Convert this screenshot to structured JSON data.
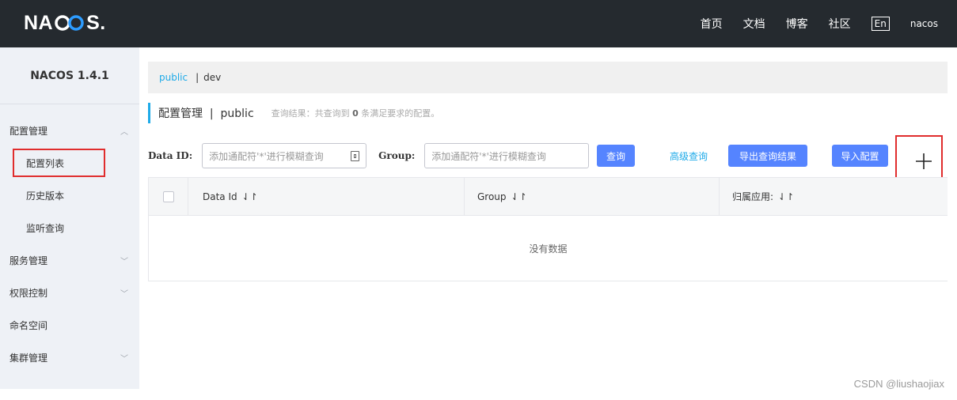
{
  "header": {
    "logo_text_left": "NA",
    "logo_text_right": "S.",
    "nav": [
      "首页",
      "文档",
      "博客",
      "社区"
    ],
    "lang": "En",
    "user": "nacos"
  },
  "sidebar": {
    "title": "NACOS 1.4.1",
    "items": [
      {
        "label": "配置管理",
        "arrow": "^"
      },
      {
        "label": "配置列表"
      },
      {
        "label": "历史版本"
      },
      {
        "label": "监听查询"
      },
      {
        "label": "服务管理",
        "arrow": "v"
      },
      {
        "label": "权限控制",
        "arrow": "v"
      },
      {
        "label": "命名空间"
      },
      {
        "label": "集群管理",
        "arrow": "v"
      }
    ]
  },
  "breadcrumb": {
    "link": "public",
    "sep": "|",
    "current": "dev"
  },
  "heading": {
    "title": "配置管理  |  public",
    "result_prefix": "查询结果：共查询到 ",
    "result_count": "0",
    "result_suffix": " 条满足要求的配置。"
  },
  "search": {
    "dataid_label": "Data ID:",
    "dataid_placeholder": "添加通配符'*'进行模糊查询",
    "group_label": "Group:",
    "group_placeholder": "添加通配符'*'进行模糊查询",
    "query_btn": "查询",
    "advanced_link": "高级查询",
    "export_btn": "导出查询结果",
    "import_btn": "导入配置"
  },
  "table": {
    "columns": [
      "Data Id",
      "Group",
      "归属应用:"
    ],
    "empty_text": "没有数据"
  },
  "watermark": "CSDN @liushaojiax",
  "colors": {
    "accent": "#1eaae8",
    "primary_button": "#5584ff",
    "highlight": "#e02d2d",
    "topbar": "#252a2f"
  }
}
